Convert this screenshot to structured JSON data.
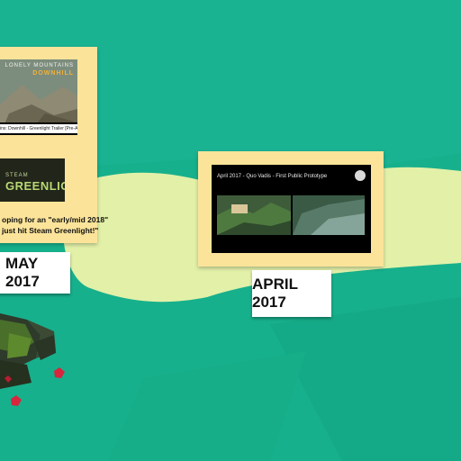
{
  "colors": {
    "background": "#17b08c",
    "hill": "#e2f0a8",
    "card": "#fbe49a",
    "tag_bg": "#ffffff"
  },
  "may_card": {
    "game_title_line1": "LONELY MOUNTAINS",
    "game_title_line2": "DOWNHILL",
    "video_caption": "ins: Downhill - Greenlight Trailer [Pre-Al...",
    "steam_small": "STEAM",
    "steam_big": "GREENLIGHT",
    "note_line1": "oping for an \"early/mid 2018\"",
    "note_line2": "just hit Steam Greenlight!\"",
    "date_label": "MAY 2017"
  },
  "april_card": {
    "video_title": "April 2017 - Quo Vadis - First Public Prototype",
    "date_label": "APRIL 2017"
  }
}
